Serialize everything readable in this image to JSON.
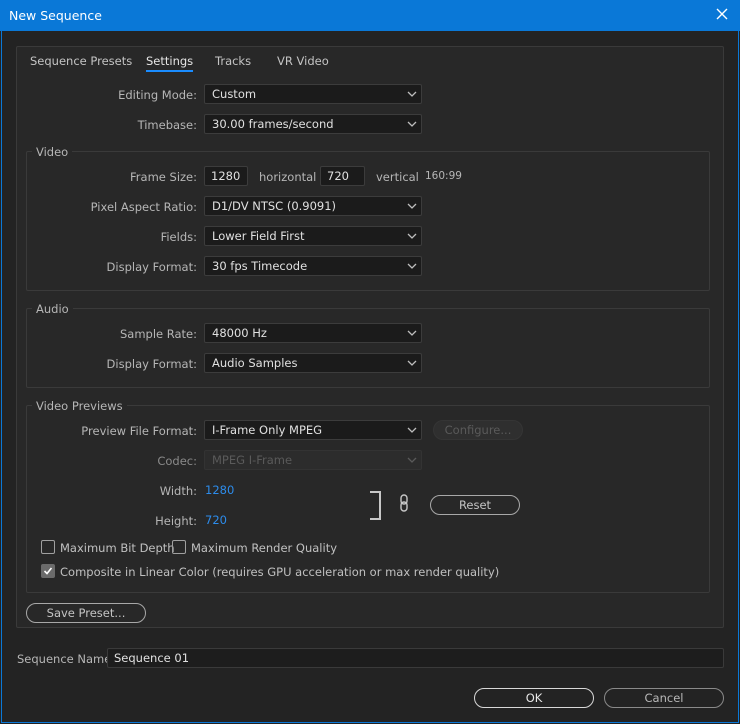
{
  "window": {
    "title": "New Sequence"
  },
  "tabs": [
    {
      "label": "Sequence Presets"
    },
    {
      "label": "Settings"
    },
    {
      "label": "Tracks"
    },
    {
      "label": "VR Video"
    }
  ],
  "settings": {
    "editing_mode": {
      "label": "Editing Mode:",
      "value": "Custom"
    },
    "timebase": {
      "label": "Timebase:",
      "value": "30.00  frames/second"
    }
  },
  "video": {
    "title": "Video",
    "frame_size": {
      "label": "Frame Size:",
      "horizontal": "1280",
      "horizontal_label": "horizontal",
      "vertical": "720",
      "vertical_label": "vertical",
      "ratio": "160:99"
    },
    "pixel_aspect_ratio": {
      "label": "Pixel Aspect Ratio:",
      "value": "D1/DV NTSC (0.9091)"
    },
    "fields": {
      "label": "Fields:",
      "value": "Lower Field First"
    },
    "display_format": {
      "label": "Display Format:",
      "value": "30 fps Timecode"
    }
  },
  "audio": {
    "title": "Audio",
    "sample_rate": {
      "label": "Sample Rate:",
      "value": "48000 Hz"
    },
    "display_format": {
      "label": "Display Format:",
      "value": "Audio Samples"
    }
  },
  "previews": {
    "title": "Video Previews",
    "preview_file_format": {
      "label": "Preview File Format:",
      "value": "I-Frame Only MPEG"
    },
    "configure_label": "Configure...",
    "codec": {
      "label": "Codec:",
      "value": "MPEG I-Frame"
    },
    "width": {
      "label": "Width:",
      "value": "1280"
    },
    "height": {
      "label": "Height:",
      "value": "720"
    },
    "reset_label": "Reset",
    "max_bit_depth": {
      "label": "Maximum Bit Depth",
      "checked": false
    },
    "max_render_quality": {
      "label": "Maximum Render Quality",
      "checked": false
    },
    "composite_linear": {
      "label": "Composite in Linear Color (requires GPU acceleration or max render quality)",
      "checked": true
    }
  },
  "save_preset_label": "Save Preset...",
  "sequence_name": {
    "label": "Sequence Name:",
    "value": "Sequence 01"
  },
  "ok_label": "OK",
  "cancel_label": "Cancel",
  "colors": {
    "accent": "#0a78d7",
    "link": "#2d8ceb",
    "background": "#232323"
  }
}
